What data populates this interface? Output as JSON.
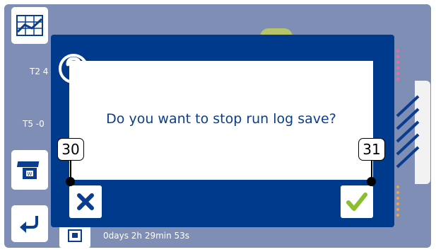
{
  "background": {
    "sensor_labels": [
      "T2 4",
      "T5 -0"
    ],
    "run_time": "0days 2h 29min 53s"
  },
  "dialog": {
    "message": "Do you want to stop run log save?",
    "cancel_icon": "close-icon",
    "confirm_icon": "check-icon",
    "help_icon": "question-mark-icon"
  },
  "annotations": {
    "cancel_callout": "30",
    "confirm_callout": "31"
  },
  "colors": {
    "dialog_bg": "#003a8c",
    "message_text": "#0a3d8f",
    "cancel_icon": "#0a3d8f",
    "confirm_icon": "#8bbf2e",
    "screen_dimmed": "#7f8eb4"
  }
}
